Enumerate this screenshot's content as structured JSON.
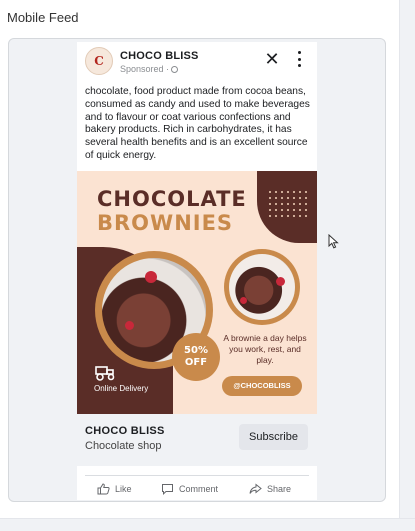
{
  "section": {
    "title": "Mobile Feed"
  },
  "post": {
    "page_name": "CHOCO BLISS",
    "sponsored_label": "Sponsored ·",
    "avatar_icon": "choco-bliss-logo",
    "close_icon": "close-icon",
    "more_icon": "more-vertical-icon",
    "text": "chocolate, food product made from cocoa beans, consumed as candy and used to make beverages and to flavour or coat various confections and bakery products. Rich in carbohydrates, it has several health benefits and is an excellent source of quick energy."
  },
  "creative": {
    "headline_line1": "CHOCOLATE",
    "headline_line2": "BROWNIES",
    "discount_line1": "50%",
    "discount_line2": "OFF",
    "delivery_label": "Online Delivery",
    "promo_text": "A brownie a day helps you work, rest, and play.",
    "handle": "@CHOCOBLISS",
    "colors": {
      "dark": "#5a2d27",
      "accent": "#c98a4b",
      "background": "#fbe3d2"
    }
  },
  "cta": {
    "title": "CHOCO BLISS",
    "subtitle": "Chocolate shop",
    "button_label": "Subscribe"
  },
  "actions": [
    {
      "label": "Like",
      "icon": "thumbs-up-icon"
    },
    {
      "label": "Comment",
      "icon": "comment-icon"
    },
    {
      "label": "Share",
      "icon": "share-icon"
    }
  ]
}
